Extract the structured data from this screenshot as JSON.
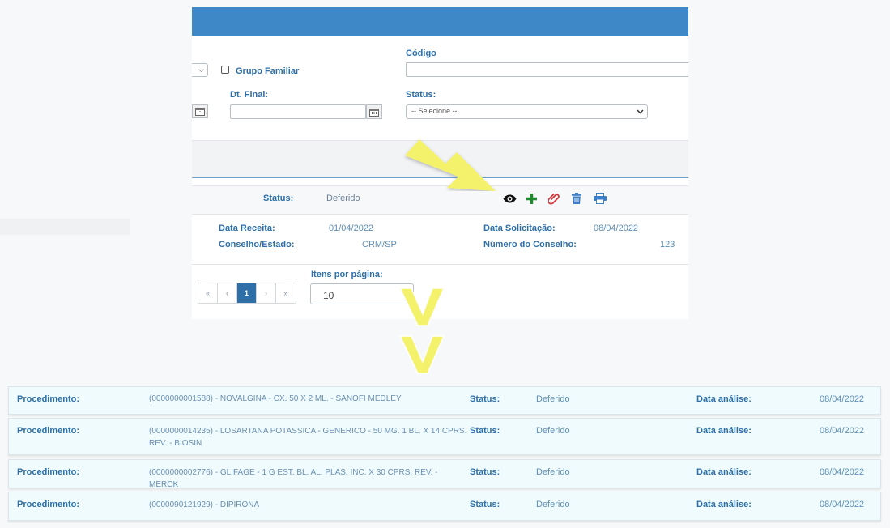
{
  "filters": {
    "grupo_familiar_label": "Grupo Familiar",
    "codigo_label": "Código",
    "codigo_value": "",
    "dt_final_label": "Dt. Final:",
    "dt_final_value": "",
    "status_label": "Status:",
    "status_selected": "-- Selecione --"
  },
  "record": {
    "status_label": "Status:",
    "status_value": "Deferido",
    "data_receita_label": "Data Receita:",
    "data_receita_value": "01/04/2022",
    "data_solicitacao_label": "Data Solicitação:",
    "data_solicitacao_value": "08/04/2022",
    "conselho_estado_label": "Conselho/Estado:",
    "conselho_estado_value": "CRM/SP",
    "numero_conselho_label": "Número do Conselho:",
    "numero_conselho_value": "123",
    "actions": [
      "eye-icon",
      "plus-icon",
      "paperclip-icon",
      "trash-icon",
      "print-icon"
    ]
  },
  "pagination": {
    "first": "«",
    "prev": "‹",
    "current": "1",
    "next": "›",
    "last": "»",
    "items_per_page_label": "Itens por página:",
    "items_per_page_value": "10"
  },
  "procedures": [
    {
      "proc_label": "Procedimento:",
      "proc_value": "(0000000001588) - NOVALGINA - CX. 50 X 2 ML. - SANOFI MEDLEY",
      "status_label": "Status:",
      "status_value": "Deferido",
      "data_label": "Data análise:",
      "data_value": "08/04/2022"
    },
    {
      "proc_label": "Procedimento:",
      "proc_value": "(0000000014235) - LOSARTANA POTASSICA - GENERICO - 50 MG. 1 BL. X 14 CPRS. REV. - BIOSIN",
      "status_label": "Status:",
      "status_value": "Deferido",
      "data_label": "Data análise:",
      "data_value": "08/04/2022"
    },
    {
      "proc_label": "Procedimento:",
      "proc_value": "(0000000002776) - GLIFAGE - 1 G EST. BL. AL. PLAS. INC. X 30 CPRS. REV. - MERCK",
      "status_label": "Status:",
      "status_value": "Deferido",
      "data_label": "Data análise:",
      "data_value": "08/04/2022"
    },
    {
      "proc_label": "Procedimento:",
      "proc_value": "(0000090121929) - DIPIRONA",
      "status_label": "Status:",
      "status_value": "Deferido",
      "data_label": "Data análise:",
      "data_value": "08/04/2022"
    }
  ],
  "colors": {
    "header_blue": "#3f88c8",
    "label_blue": "#2e6fa7",
    "value_blue": "#5f8fb5",
    "arrow_yellow": "#f4f26a",
    "row_bg": "#effbfd"
  }
}
